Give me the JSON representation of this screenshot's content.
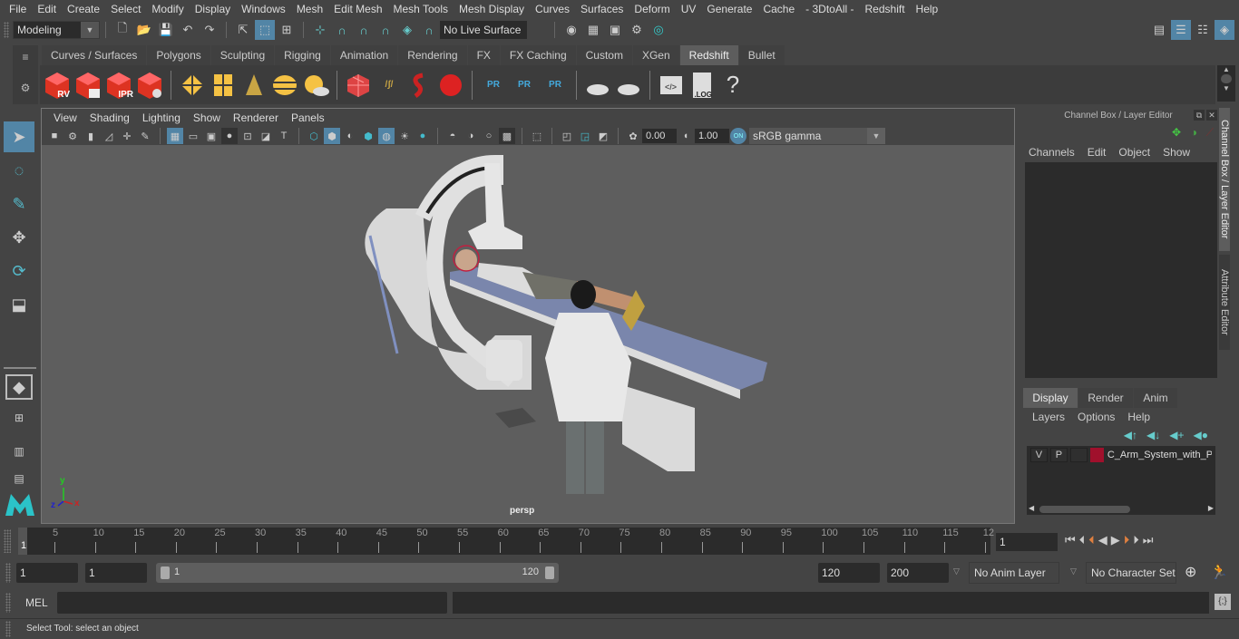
{
  "menubar": {
    "items": [
      "File",
      "Edit",
      "Create",
      "Select",
      "Modify",
      "Display",
      "Windows",
      "Mesh",
      "Edit Mesh",
      "Mesh Tools",
      "Mesh Display",
      "Curves",
      "Surfaces",
      "Deform",
      "UV",
      "Generate",
      "Cache",
      "- 3DtoAll -",
      "Redshift",
      "Help"
    ]
  },
  "statusline": {
    "menuset": "Modeling",
    "live_surface": "No Live Surface"
  },
  "shelf": {
    "tabs": [
      "Curves / Surfaces",
      "Polygons",
      "Sculpting",
      "Rigging",
      "Animation",
      "Rendering",
      "FX",
      "FX Caching",
      "Custom",
      "XGen",
      "Redshift",
      "Bullet"
    ],
    "active_tab": "Redshift",
    "icon_labels": {
      "rv": "RV",
      "ipr": "IPR",
      "pr": "PR",
      "log": ".LOG",
      "help": "?"
    }
  },
  "viewport": {
    "menus": [
      "View",
      "Shading",
      "Lighting",
      "Show",
      "Renderer",
      "Panels"
    ],
    "exposure": "0.00",
    "gamma": "1.00",
    "color_mgmt_toggle": "ON",
    "color_space": "sRGB gamma",
    "camera_label": "persp",
    "axis": {
      "x": "x",
      "y": "y",
      "z": "z"
    }
  },
  "channel_box": {
    "title": "Channel Box / Layer Editor",
    "menus": [
      "Channels",
      "Edit",
      "Object",
      "Show"
    ]
  },
  "layer_editor": {
    "tabs": [
      "Display",
      "Render",
      "Anim"
    ],
    "active_tab": "Display",
    "menus": [
      "Layers",
      "Options",
      "Help"
    ],
    "layers": [
      {
        "visible": "V",
        "playback": "P",
        "color": "#a0102c",
        "name": "C_Arm_System_with_Pa"
      }
    ]
  },
  "side_tabs": [
    "Channel Box / Layer Editor",
    "Attribute Editor"
  ],
  "timeline": {
    "ticks": [
      "5",
      "10",
      "15",
      "20",
      "25",
      "30",
      "35",
      "40",
      "45",
      "50",
      "55",
      "60",
      "65",
      "70",
      "75",
      "80",
      "85",
      "90",
      "95",
      "100",
      "105",
      "110",
      "115",
      "12"
    ],
    "current_marker": "1",
    "current_frame": "1"
  },
  "range": {
    "start_time": "1",
    "playback_start": "1",
    "slider_start": "1",
    "slider_end": "120",
    "playback_end": "120",
    "end_time": "200",
    "anim_layer": "No Anim Layer",
    "character_set": "No Character Set"
  },
  "command_line": {
    "label": "MEL",
    "value": ""
  },
  "help_line": {
    "text": "Select Tool: select an object"
  }
}
